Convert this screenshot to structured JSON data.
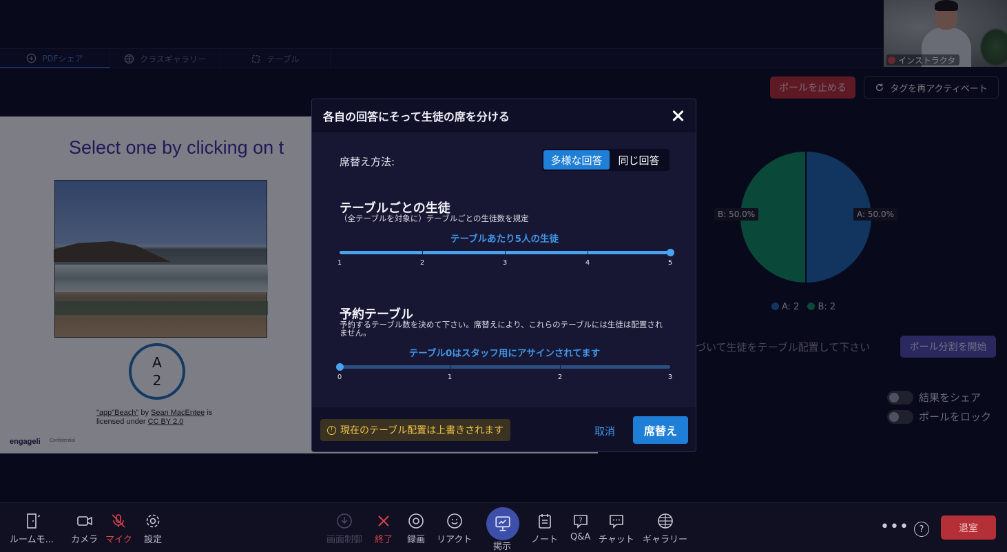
{
  "tabs": [
    {
      "label": "PDFシェア",
      "icon": "pdf-share-icon"
    },
    {
      "label": "クラスギャラリー",
      "icon": "grid-icon"
    },
    {
      "label": "テーブル",
      "icon": "table-icon"
    }
  ],
  "video": {
    "name": "インストラクタ"
  },
  "poll": {
    "stop_label": "ポールを止める",
    "reactivate_label": "タグを再アクティベート",
    "instruction": "づいて生徒をテーブル配置して下さい",
    "start_split_label": "ポール分割を開始",
    "share_results_label": "結果をシェア",
    "lock_poll_label": "ポールをロック",
    "colors": {
      "A": "#1d64aa",
      "B": "#0e8a5e"
    }
  },
  "chart_data": {
    "type": "pie",
    "categories": [
      "A",
      "B"
    ],
    "values": [
      2,
      2
    ],
    "slice_labels": [
      "A: 50.0%",
      "B: 50.0%"
    ],
    "legend": [
      "A: 2",
      "B: 2"
    ]
  },
  "slide": {
    "title": "Select one by clicking on t",
    "answer_letter": "A",
    "answer_count": "2",
    "credit_quote": "\"app\"Beach\"",
    "credit_by": " by ",
    "credit_author": "Sean MacEntee",
    "credit_is": " is",
    "credit_licensed": "licensed under ",
    "credit_license": "CC BY 2.0",
    "logo": "engageli",
    "confidential": "Confidential"
  },
  "dialog": {
    "title": "各自の回答にそって生徒の席を分ける",
    "method_label": "席替え方法:",
    "method_options": [
      "多様な回答",
      "同じ回答"
    ],
    "per_table": {
      "title": "テーブルごとの生徒",
      "desc": "（全テーブルを対象に）テーブルごとの生徒数を規定",
      "caption": "テーブルあたり5人の生徒",
      "ticks": [
        "1",
        "2",
        "3",
        "4",
        "5"
      ],
      "value": 5
    },
    "reserved": {
      "title": "予約テーブル",
      "desc": "予約するテーブル数を決めて下さい。席替えにより、これらのテーブルには生徒は配置されません。",
      "caption": "テーブル0はスタッフ用にアサインされてます",
      "ticks": [
        "0",
        "1",
        "2",
        "3"
      ],
      "value": 0
    },
    "warning": "現在のテーブル配置は上書きされます",
    "cancel_label": "取消",
    "confirm_label": "席替え"
  },
  "toolbar": {
    "room_mode": "ルームモ...",
    "camera": "カメラ",
    "mic": "マイク",
    "settings": "設定",
    "screen_control": "画面制御",
    "end": "終了",
    "record": "録画",
    "react": "リアクト",
    "present": "掲示",
    "notes": "ノート",
    "qa": "Q&A",
    "chat": "チャット",
    "gallery": "ギャラリー",
    "leave": "退室"
  }
}
